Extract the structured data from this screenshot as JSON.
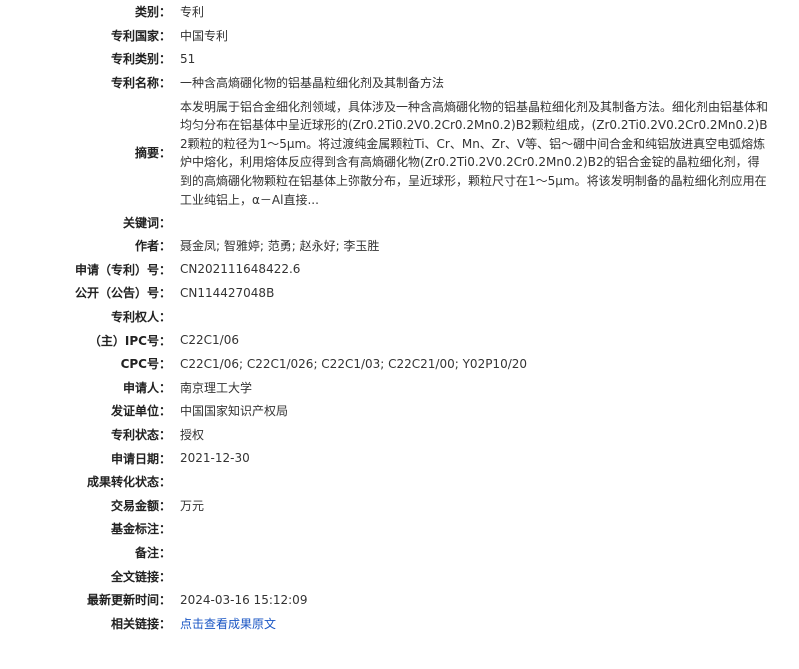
{
  "record": {
    "type": {
      "label": "类别：",
      "value": "专利"
    },
    "country": {
      "label": "专利国家：",
      "value": "中国专利"
    },
    "patent_category": {
      "label": "专利类别：",
      "value": "51"
    },
    "title": {
      "label": "专利名称：",
      "value": "一种含高熵硼化物的铝基晶粒细化剂及其制备方法"
    },
    "abstract": {
      "label": "摘要：",
      "value": "本发明属于铝合金细化剂领域，具体涉及一种含高熵硼化物的铝基晶粒细化剂及其制备方法。细化剂由铝基体和均匀分布在铝基体中呈近球形的(Zr0.2Ti0.2V0.2Cr0.2Mn0.2)B2颗粒组成，(Zr0.2Ti0.2V0.2Cr0.2Mn0.2)B2颗粒的粒径为1～5μm。将过渡纯金属颗粒Ti、Cr、Mn、Zr、V等、铝～硼中间合金和纯铝放进真空电弧熔炼炉中熔化，利用熔体反应得到含有高熵硼化物(Zr0.2Ti0.2V0.2Cr0.2Mn0.2)B2的铝合金锭的晶粒细化剂，得到的高熵硼化物颗粒在铝基体上弥散分布，呈近球形，颗粒尺寸在1～5μm。将该发明制备的晶粒细化剂应用在工业纯铝上，α－Al直接..."
    },
    "keywords": {
      "label": "关键词：",
      "value": ""
    },
    "authors": {
      "label": "作者：",
      "value": "聂金凤; 智雅婷; 范勇; 赵永好; 李玉胜"
    },
    "application_no": {
      "label": "申请（专利）号：",
      "value": "CN202111648422.6"
    },
    "publication_no": {
      "label": "公开（公告）号：",
      "value": "CN114427048B"
    },
    "patentee": {
      "label": "专利权人：",
      "value": ""
    },
    "main_ipc": {
      "label": "（主）IPC号：",
      "value": "C22C1/06"
    },
    "cpc": {
      "label": "CPC号：",
      "value": "C22C1/06; C22C1/026; C22C1/03; C22C21/00; Y02P10/20"
    },
    "applicant": {
      "label": "申请人：",
      "value": "南京理工大学"
    },
    "issuing_unit": {
      "label": "发证单位：",
      "value": "中国国家知识产权局"
    },
    "status": {
      "label": "专利状态：",
      "value": "授权"
    },
    "application_date": {
      "label": "申请日期：",
      "value": "2021-12-30"
    },
    "transfer_status": {
      "label": "成果转化状态：",
      "value": ""
    },
    "transaction_amount": {
      "label": "交易金额：",
      "value": "万元"
    },
    "funding": {
      "label": "基金标注：",
      "value": ""
    },
    "remarks": {
      "label": "备注：",
      "value": ""
    },
    "full_text_link": {
      "label": "全文链接：",
      "value": ""
    },
    "last_updated": {
      "label": "最新更新时间：",
      "value": "2024-03-16 15:12:09"
    },
    "related_link": {
      "label": "相关链接：",
      "value": "点击查看成果原文"
    }
  },
  "colors": {
    "label": "#222222",
    "value": "#333333",
    "link": "#1a56c4",
    "background": "#ffffff"
  }
}
